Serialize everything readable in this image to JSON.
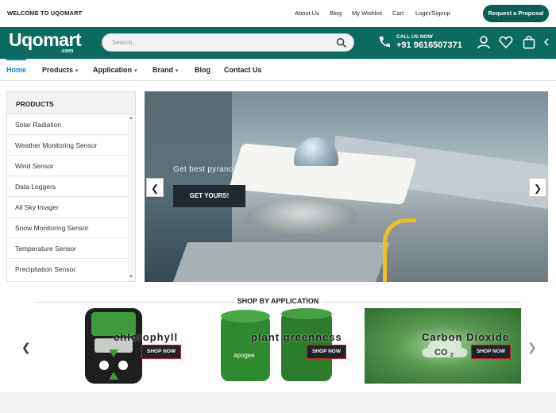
{
  "topbar": {
    "welcome": "WELCOME TO UQOMART",
    "links": [
      "About Us",
      "Blog",
      "My Wishlist",
      "Cart",
      "Login/Signup"
    ],
    "proposal_button": "Request a Proposal"
  },
  "header": {
    "logo": "Uqomart",
    "logo_sub": ".com",
    "search_placeholder": "Search...",
    "call_label": "CALL US NOW",
    "phone": "+91 9616507371",
    "icons": [
      "user-icon",
      "heart-icon",
      "cart-icon",
      "chevron-left-icon"
    ]
  },
  "nav": {
    "items": [
      {
        "label": "Home",
        "dropdown": false,
        "active": true
      },
      {
        "label": "Products",
        "dropdown": true,
        "active": false
      },
      {
        "label": "Application",
        "dropdown": true,
        "active": false
      },
      {
        "label": "Brand",
        "dropdown": true,
        "active": false
      },
      {
        "label": "Blog",
        "dropdown": false,
        "active": false
      },
      {
        "label": "Contact Us",
        "dropdown": false,
        "active": false
      }
    ]
  },
  "sidebar": {
    "title": "PRODUCTS",
    "items": [
      "Solar Radiation",
      "Weather Monitoring Sensor",
      "Wind Sensor",
      "Data Loggers",
      "All Sky Imager",
      "Snow Monitoring Sensor",
      "Temperature Sensor",
      "Precipitation Sensor"
    ]
  },
  "hero": {
    "caption": "Get best pyrano",
    "button": "GET YOURS!",
    "prev": "❮",
    "next": "❯"
  },
  "shop": {
    "title": "SHOP BY APPLICATION",
    "cards": [
      {
        "label": "chlorophyll",
        "button": "SHOP NOW"
      },
      {
        "label": "plant greenness",
        "button": "SHOP NOW"
      },
      {
        "label": "Carbon Dioxide",
        "button": "SHOP NOW"
      }
    ],
    "prev": "❮",
    "next": "❯"
  },
  "colors": {
    "brand_green": "#0b6b5f",
    "link_blue": "#1a7fc1",
    "dark_button": "#1f2a30"
  }
}
